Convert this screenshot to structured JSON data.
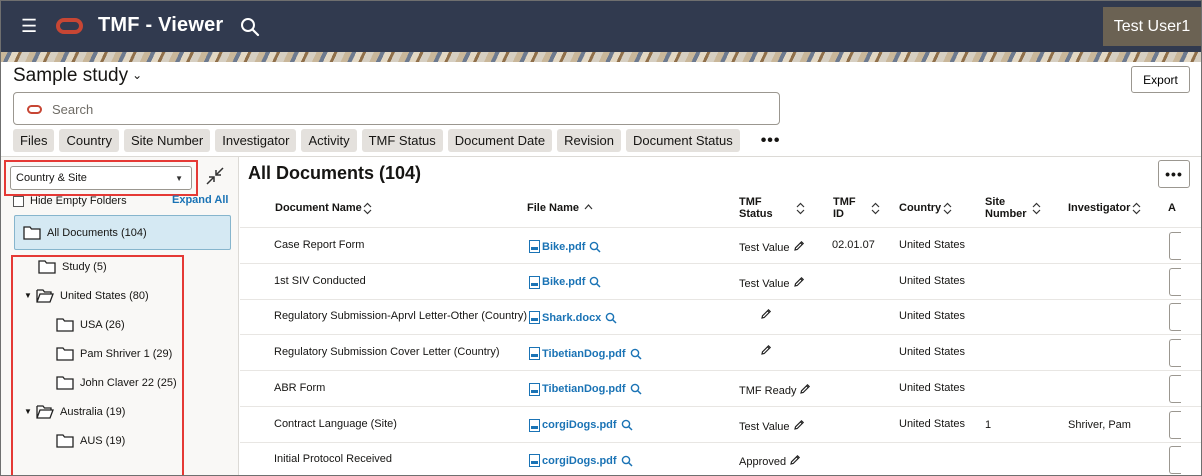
{
  "header": {
    "menu_icon": "hamburger-icon",
    "app_title": "TMF - Viewer",
    "user": "Test User1"
  },
  "study": {
    "name": "Sample study",
    "export_label": "Export",
    "search_placeholder": "Search"
  },
  "filters": [
    "Files",
    "Country",
    "Site Number",
    "Investigator",
    "Activity",
    "TMF Status",
    "Document Date",
    "Revision",
    "Document Status"
  ],
  "filters_more": "•••",
  "left": {
    "view_select": "Country & Site",
    "hide_empty": "Hide Empty Folders",
    "expand_all": "Expand All",
    "all_documents": "All Documents (104)",
    "tree": [
      {
        "label": "Study (5)",
        "level": 1,
        "expanded": null
      },
      {
        "label": "United States (80)",
        "level": 0,
        "expanded": true
      },
      {
        "label": "USA (26)",
        "level": 2,
        "expanded": null
      },
      {
        "label": "Pam Shriver 1 (29)",
        "level": 2,
        "expanded": null
      },
      {
        "label": "John Claver 22 (25)",
        "level": 2,
        "expanded": null
      },
      {
        "label": "Australia (19)",
        "level": 0,
        "expanded": true
      },
      {
        "label": "AUS (19)",
        "level": 2,
        "expanded": null
      }
    ]
  },
  "main": {
    "title": "All Documents (104)",
    "more_label": "•••",
    "columns": [
      "Document Name",
      "File Name",
      "TMF Status",
      "TMF ID",
      "Country",
      "Site Number",
      "Investigator",
      "A"
    ],
    "rows": [
      {
        "doc": "Case Report Form",
        "file": "Bike.pdf",
        "status": "Test Value",
        "tmf_id": "02.01.07",
        "country": "United States",
        "site": "",
        "investigator": ""
      },
      {
        "doc": "1st SIV Conducted",
        "file": "Bike.pdf",
        "status": "Test Value",
        "tmf_id": "",
        "country": "United States",
        "site": "",
        "investigator": ""
      },
      {
        "doc": "Regulatory Submission-Aprvl Letter-Other (Country)",
        "file": "Shark.docx",
        "status": "",
        "tmf_id": "",
        "country": "United States",
        "site": "",
        "investigator": ""
      },
      {
        "doc": "Regulatory Submission Cover Letter (Country)",
        "file": "TibetianDog.pdf",
        "status": "",
        "tmf_id": "",
        "country": "United States",
        "site": "",
        "investigator": ""
      },
      {
        "doc": "ABR Form",
        "file": "TibetianDog.pdf",
        "status": "TMF Ready",
        "tmf_id": "",
        "country": "United States",
        "site": "",
        "investigator": ""
      },
      {
        "doc": "Contract Language (Site)",
        "file": "corgiDogs.pdf",
        "status": "Test Value",
        "tmf_id": "",
        "country": "United States",
        "site": "1",
        "investigator": "Shriver, Pam"
      },
      {
        "doc": "Initial Protocol Received",
        "file": "corgiDogs.pdf",
        "status": "Approved",
        "tmf_id": "",
        "country": "",
        "site": "",
        "investigator": ""
      }
    ]
  },
  "colors": {
    "header_bg": "#313a4f",
    "accent_red": "#c74634",
    "link_blue": "#1a73b5",
    "highlight_red": "#e53935",
    "selected_bg": "#d5e9f3"
  }
}
